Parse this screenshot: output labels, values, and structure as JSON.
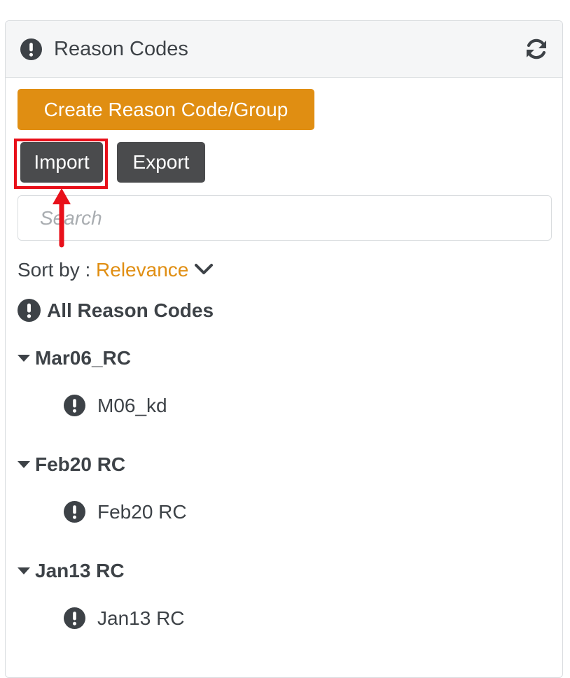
{
  "panel": {
    "title": "Reason Codes",
    "header_icon": "exclamation-circle-icon",
    "refresh_icon": "refresh-icon"
  },
  "toolbar": {
    "create_label": "Create Reason Code/Group",
    "import_label": "Import",
    "export_label": "Export"
  },
  "search": {
    "placeholder": "Search",
    "value": ""
  },
  "sort": {
    "label": "Sort by : ",
    "value": "Relevance"
  },
  "all_codes": {
    "label": "All Reason Codes"
  },
  "groups": [
    {
      "name": "Mar06_RC",
      "items": [
        {
          "name": "M06_kd"
        }
      ]
    },
    {
      "name": "Feb20 RC",
      "items": [
        {
          "name": "Feb20 RC"
        }
      ]
    },
    {
      "name": "Jan13 RC",
      "items": [
        {
          "name": "Jan13 RC"
        }
      ]
    }
  ],
  "colors": {
    "accent": "#e08e12",
    "dark_button": "#4a4b4d",
    "text": "#3d4247",
    "highlight": "#e8101a"
  }
}
